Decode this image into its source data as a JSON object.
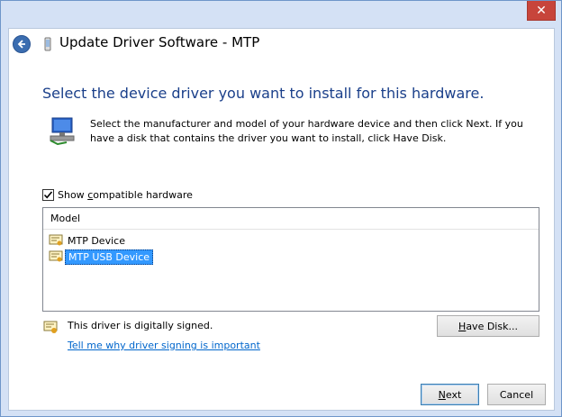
{
  "window": {
    "title": "Update Driver Software - MTP",
    "close_glyph": "✕"
  },
  "heading": "Select the device driver you want to install for this hardware.",
  "description": "Select the manufacturer and model of your hardware device and then click Next. If you have a disk that contains the driver you want to install, click Have Disk.",
  "show_compatible": {
    "checked": true,
    "label_pre": "Show ",
    "label_access": "c",
    "label_post": "ompatible hardware"
  },
  "model_list": {
    "header": "Model",
    "items": [
      {
        "label": "MTP Device",
        "selected": false
      },
      {
        "label": "MTP USB Device",
        "selected": true
      }
    ]
  },
  "signing": {
    "status": "This driver is digitally signed.",
    "link": "Tell me why driver signing is important"
  },
  "buttons": {
    "have_disk_access": "H",
    "have_disk_rest": "ave Disk...",
    "next_access": "N",
    "next_rest": "ext",
    "cancel": "Cancel"
  }
}
